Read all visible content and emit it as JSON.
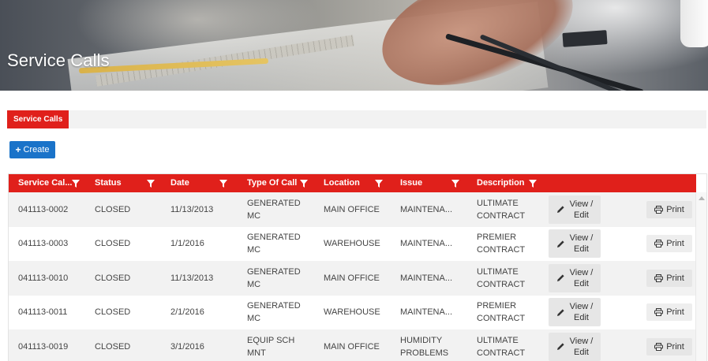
{
  "page": {
    "title": "Service Calls"
  },
  "tabs": [
    {
      "label": "Service Calls",
      "active": true
    }
  ],
  "toolbar": {
    "create_label": "Create",
    "create_icon": "plus-icon"
  },
  "colors": {
    "accent": "#e0201b",
    "primary_button": "#1a73c9",
    "row_alt": "#f2f2f2"
  },
  "grid": {
    "columns": [
      {
        "label": "Service Cal...",
        "filter_icon": "filter-icon"
      },
      {
        "label": "Status",
        "filter_icon": "filter-icon"
      },
      {
        "label": "Date",
        "filter_icon": "filter-icon"
      },
      {
        "label": "Type Of Call",
        "filter_icon": "filter-icon"
      },
      {
        "label": "Location",
        "filter_icon": "filter-icon"
      },
      {
        "label": "Issue",
        "filter_icon": "filter-icon"
      },
      {
        "label": "Description",
        "filter_icon": "filter-icon"
      }
    ],
    "view_label_1": "View /",
    "view_label_2": "Edit",
    "print_label": "Print",
    "rows": [
      {
        "id": "041113-0002",
        "status": "CLOSED",
        "date": "11/13/2013",
        "type": "GENERATED MC",
        "location": "MAIN OFFICE",
        "issue": "MAINTENA...",
        "description": "ULTIMATE CONTRACT"
      },
      {
        "id": "041113-0003",
        "status": "CLOSED",
        "date": "1/1/2016",
        "type": "GENERATED MC",
        "location": "WAREHOUSE",
        "issue": "MAINTENA...",
        "description": "PREMIER CONTRACT"
      },
      {
        "id": "041113-0010",
        "status": "CLOSED",
        "date": "11/13/2013",
        "type": "GENERATED MC",
        "location": "MAIN OFFICE",
        "issue": "MAINTENA...",
        "description": "ULTIMATE CONTRACT"
      },
      {
        "id": "041113-0011",
        "status": "CLOSED",
        "date": "2/1/2016",
        "type": "GENERATED MC",
        "location": "WAREHOUSE",
        "issue": "MAINTENA...",
        "description": "PREMIER CONTRACT"
      },
      {
        "id": "041113-0019",
        "status": "CLOSED",
        "date": "3/1/2016",
        "type": "EQUIP SCH MNT",
        "location": "MAIN OFFICE",
        "issue": "HUMIDITY PROBLEMS",
        "description": "ULTIMATE CONTRACT"
      }
    ]
  }
}
